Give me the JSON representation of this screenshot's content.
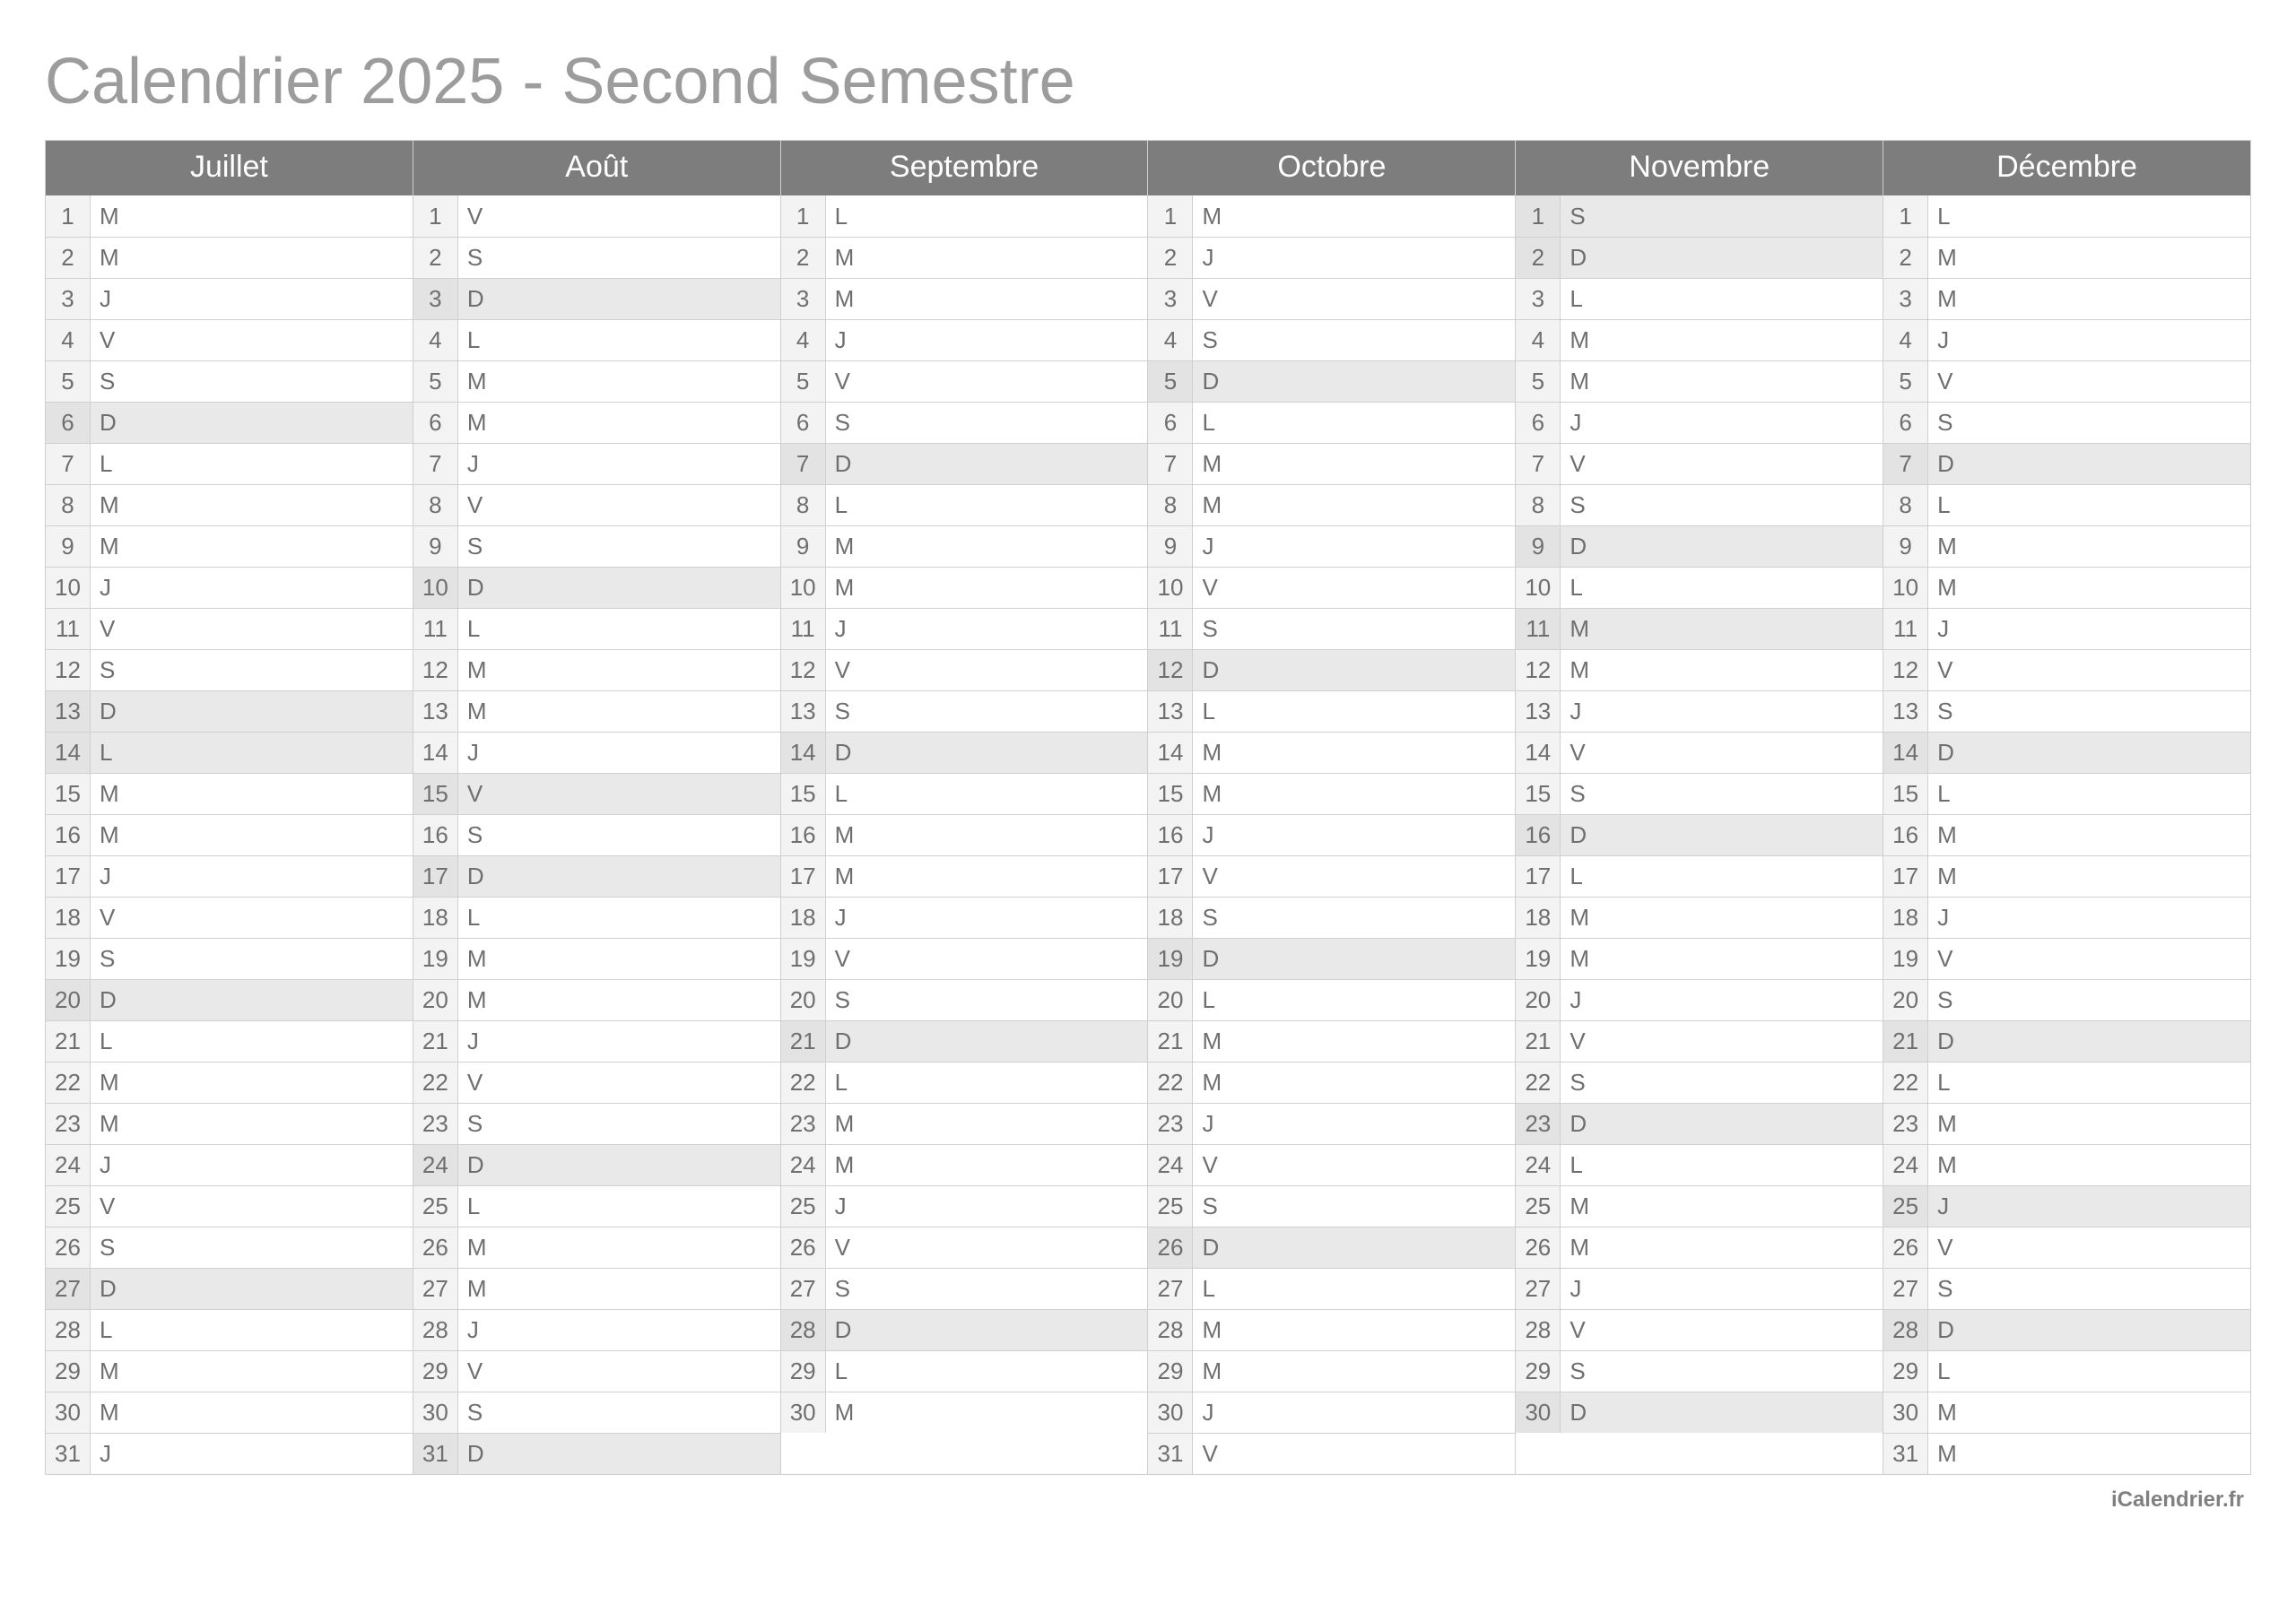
{
  "title": "Calendrier 2025 - Second Semestre",
  "footer": "iCalendrier.fr",
  "months": [
    {
      "name": "Juillet",
      "days": [
        {
          "n": 1,
          "wd": "M",
          "shaded": false
        },
        {
          "n": 2,
          "wd": "M",
          "shaded": false
        },
        {
          "n": 3,
          "wd": "J",
          "shaded": false
        },
        {
          "n": 4,
          "wd": "V",
          "shaded": false
        },
        {
          "n": 5,
          "wd": "S",
          "shaded": false
        },
        {
          "n": 6,
          "wd": "D",
          "shaded": true
        },
        {
          "n": 7,
          "wd": "L",
          "shaded": false
        },
        {
          "n": 8,
          "wd": "M",
          "shaded": false
        },
        {
          "n": 9,
          "wd": "M",
          "shaded": false
        },
        {
          "n": 10,
          "wd": "J",
          "shaded": false
        },
        {
          "n": 11,
          "wd": "V",
          "shaded": false
        },
        {
          "n": 12,
          "wd": "S",
          "shaded": false
        },
        {
          "n": 13,
          "wd": "D",
          "shaded": true
        },
        {
          "n": 14,
          "wd": "L",
          "shaded": true
        },
        {
          "n": 15,
          "wd": "M",
          "shaded": false
        },
        {
          "n": 16,
          "wd": "M",
          "shaded": false
        },
        {
          "n": 17,
          "wd": "J",
          "shaded": false
        },
        {
          "n": 18,
          "wd": "V",
          "shaded": false
        },
        {
          "n": 19,
          "wd": "S",
          "shaded": false
        },
        {
          "n": 20,
          "wd": "D",
          "shaded": true
        },
        {
          "n": 21,
          "wd": "L",
          "shaded": false
        },
        {
          "n": 22,
          "wd": "M",
          "shaded": false
        },
        {
          "n": 23,
          "wd": "M",
          "shaded": false
        },
        {
          "n": 24,
          "wd": "J",
          "shaded": false
        },
        {
          "n": 25,
          "wd": "V",
          "shaded": false
        },
        {
          "n": 26,
          "wd": "S",
          "shaded": false
        },
        {
          "n": 27,
          "wd": "D",
          "shaded": true
        },
        {
          "n": 28,
          "wd": "L",
          "shaded": false
        },
        {
          "n": 29,
          "wd": "M",
          "shaded": false
        },
        {
          "n": 30,
          "wd": "M",
          "shaded": false
        },
        {
          "n": 31,
          "wd": "J",
          "shaded": false
        }
      ]
    },
    {
      "name": "Août",
      "days": [
        {
          "n": 1,
          "wd": "V",
          "shaded": false
        },
        {
          "n": 2,
          "wd": "S",
          "shaded": false
        },
        {
          "n": 3,
          "wd": "D",
          "shaded": true
        },
        {
          "n": 4,
          "wd": "L",
          "shaded": false
        },
        {
          "n": 5,
          "wd": "M",
          "shaded": false
        },
        {
          "n": 6,
          "wd": "M",
          "shaded": false
        },
        {
          "n": 7,
          "wd": "J",
          "shaded": false
        },
        {
          "n": 8,
          "wd": "V",
          "shaded": false
        },
        {
          "n": 9,
          "wd": "S",
          "shaded": false
        },
        {
          "n": 10,
          "wd": "D",
          "shaded": true
        },
        {
          "n": 11,
          "wd": "L",
          "shaded": false
        },
        {
          "n": 12,
          "wd": "M",
          "shaded": false
        },
        {
          "n": 13,
          "wd": "M",
          "shaded": false
        },
        {
          "n": 14,
          "wd": "J",
          "shaded": false
        },
        {
          "n": 15,
          "wd": "V",
          "shaded": true
        },
        {
          "n": 16,
          "wd": "S",
          "shaded": false
        },
        {
          "n": 17,
          "wd": "D",
          "shaded": true
        },
        {
          "n": 18,
          "wd": "L",
          "shaded": false
        },
        {
          "n": 19,
          "wd": "M",
          "shaded": false
        },
        {
          "n": 20,
          "wd": "M",
          "shaded": false
        },
        {
          "n": 21,
          "wd": "J",
          "shaded": false
        },
        {
          "n": 22,
          "wd": "V",
          "shaded": false
        },
        {
          "n": 23,
          "wd": "S",
          "shaded": false
        },
        {
          "n": 24,
          "wd": "D",
          "shaded": true
        },
        {
          "n": 25,
          "wd": "L",
          "shaded": false
        },
        {
          "n": 26,
          "wd": "M",
          "shaded": false
        },
        {
          "n": 27,
          "wd": "M",
          "shaded": false
        },
        {
          "n": 28,
          "wd": "J",
          "shaded": false
        },
        {
          "n": 29,
          "wd": "V",
          "shaded": false
        },
        {
          "n": 30,
          "wd": "S",
          "shaded": false
        },
        {
          "n": 31,
          "wd": "D",
          "shaded": true
        }
      ]
    },
    {
      "name": "Septembre",
      "days": [
        {
          "n": 1,
          "wd": "L",
          "shaded": false
        },
        {
          "n": 2,
          "wd": "M",
          "shaded": false
        },
        {
          "n": 3,
          "wd": "M",
          "shaded": false
        },
        {
          "n": 4,
          "wd": "J",
          "shaded": false
        },
        {
          "n": 5,
          "wd": "V",
          "shaded": false
        },
        {
          "n": 6,
          "wd": "S",
          "shaded": false
        },
        {
          "n": 7,
          "wd": "D",
          "shaded": true
        },
        {
          "n": 8,
          "wd": "L",
          "shaded": false
        },
        {
          "n": 9,
          "wd": "M",
          "shaded": false
        },
        {
          "n": 10,
          "wd": "M",
          "shaded": false
        },
        {
          "n": 11,
          "wd": "J",
          "shaded": false
        },
        {
          "n": 12,
          "wd": "V",
          "shaded": false
        },
        {
          "n": 13,
          "wd": "S",
          "shaded": false
        },
        {
          "n": 14,
          "wd": "D",
          "shaded": true
        },
        {
          "n": 15,
          "wd": "L",
          "shaded": false
        },
        {
          "n": 16,
          "wd": "M",
          "shaded": false
        },
        {
          "n": 17,
          "wd": "M",
          "shaded": false
        },
        {
          "n": 18,
          "wd": "J",
          "shaded": false
        },
        {
          "n": 19,
          "wd": "V",
          "shaded": false
        },
        {
          "n": 20,
          "wd": "S",
          "shaded": false
        },
        {
          "n": 21,
          "wd": "D",
          "shaded": true
        },
        {
          "n": 22,
          "wd": "L",
          "shaded": false
        },
        {
          "n": 23,
          "wd": "M",
          "shaded": false
        },
        {
          "n": 24,
          "wd": "M",
          "shaded": false
        },
        {
          "n": 25,
          "wd": "J",
          "shaded": false
        },
        {
          "n": 26,
          "wd": "V",
          "shaded": false
        },
        {
          "n": 27,
          "wd": "S",
          "shaded": false
        },
        {
          "n": 28,
          "wd": "D",
          "shaded": true
        },
        {
          "n": 29,
          "wd": "L",
          "shaded": false
        },
        {
          "n": 30,
          "wd": "M",
          "shaded": false
        }
      ]
    },
    {
      "name": "Octobre",
      "days": [
        {
          "n": 1,
          "wd": "M",
          "shaded": false
        },
        {
          "n": 2,
          "wd": "J",
          "shaded": false
        },
        {
          "n": 3,
          "wd": "V",
          "shaded": false
        },
        {
          "n": 4,
          "wd": "S",
          "shaded": false
        },
        {
          "n": 5,
          "wd": "D",
          "shaded": true
        },
        {
          "n": 6,
          "wd": "L",
          "shaded": false
        },
        {
          "n": 7,
          "wd": "M",
          "shaded": false
        },
        {
          "n": 8,
          "wd": "M",
          "shaded": false
        },
        {
          "n": 9,
          "wd": "J",
          "shaded": false
        },
        {
          "n": 10,
          "wd": "V",
          "shaded": false
        },
        {
          "n": 11,
          "wd": "S",
          "shaded": false
        },
        {
          "n": 12,
          "wd": "D",
          "shaded": true
        },
        {
          "n": 13,
          "wd": "L",
          "shaded": false
        },
        {
          "n": 14,
          "wd": "M",
          "shaded": false
        },
        {
          "n": 15,
          "wd": "M",
          "shaded": false
        },
        {
          "n": 16,
          "wd": "J",
          "shaded": false
        },
        {
          "n": 17,
          "wd": "V",
          "shaded": false
        },
        {
          "n": 18,
          "wd": "S",
          "shaded": false
        },
        {
          "n": 19,
          "wd": "D",
          "shaded": true
        },
        {
          "n": 20,
          "wd": "L",
          "shaded": false
        },
        {
          "n": 21,
          "wd": "M",
          "shaded": false
        },
        {
          "n": 22,
          "wd": "M",
          "shaded": false
        },
        {
          "n": 23,
          "wd": "J",
          "shaded": false
        },
        {
          "n": 24,
          "wd": "V",
          "shaded": false
        },
        {
          "n": 25,
          "wd": "S",
          "shaded": false
        },
        {
          "n": 26,
          "wd": "D",
          "shaded": true
        },
        {
          "n": 27,
          "wd": "L",
          "shaded": false
        },
        {
          "n": 28,
          "wd": "M",
          "shaded": false
        },
        {
          "n": 29,
          "wd": "M",
          "shaded": false
        },
        {
          "n": 30,
          "wd": "J",
          "shaded": false
        },
        {
          "n": 31,
          "wd": "V",
          "shaded": false
        }
      ]
    },
    {
      "name": "Novembre",
      "days": [
        {
          "n": 1,
          "wd": "S",
          "shaded": true
        },
        {
          "n": 2,
          "wd": "D",
          "shaded": true
        },
        {
          "n": 3,
          "wd": "L",
          "shaded": false
        },
        {
          "n": 4,
          "wd": "M",
          "shaded": false
        },
        {
          "n": 5,
          "wd": "M",
          "shaded": false
        },
        {
          "n": 6,
          "wd": "J",
          "shaded": false
        },
        {
          "n": 7,
          "wd": "V",
          "shaded": false
        },
        {
          "n": 8,
          "wd": "S",
          "shaded": false
        },
        {
          "n": 9,
          "wd": "D",
          "shaded": true
        },
        {
          "n": 10,
          "wd": "L",
          "shaded": false
        },
        {
          "n": 11,
          "wd": "M",
          "shaded": true
        },
        {
          "n": 12,
          "wd": "M",
          "shaded": false
        },
        {
          "n": 13,
          "wd": "J",
          "shaded": false
        },
        {
          "n": 14,
          "wd": "V",
          "shaded": false
        },
        {
          "n": 15,
          "wd": "S",
          "shaded": false
        },
        {
          "n": 16,
          "wd": "D",
          "shaded": true
        },
        {
          "n": 17,
          "wd": "L",
          "shaded": false
        },
        {
          "n": 18,
          "wd": "M",
          "shaded": false
        },
        {
          "n": 19,
          "wd": "M",
          "shaded": false
        },
        {
          "n": 20,
          "wd": "J",
          "shaded": false
        },
        {
          "n": 21,
          "wd": "V",
          "shaded": false
        },
        {
          "n": 22,
          "wd": "S",
          "shaded": false
        },
        {
          "n": 23,
          "wd": "D",
          "shaded": true
        },
        {
          "n": 24,
          "wd": "L",
          "shaded": false
        },
        {
          "n": 25,
          "wd": "M",
          "shaded": false
        },
        {
          "n": 26,
          "wd": "M",
          "shaded": false
        },
        {
          "n": 27,
          "wd": "J",
          "shaded": false
        },
        {
          "n": 28,
          "wd": "V",
          "shaded": false
        },
        {
          "n": 29,
          "wd": "S",
          "shaded": false
        },
        {
          "n": 30,
          "wd": "D",
          "shaded": true
        }
      ]
    },
    {
      "name": "Décembre",
      "days": [
        {
          "n": 1,
          "wd": "L",
          "shaded": false
        },
        {
          "n": 2,
          "wd": "M",
          "shaded": false
        },
        {
          "n": 3,
          "wd": "M",
          "shaded": false
        },
        {
          "n": 4,
          "wd": "J",
          "shaded": false
        },
        {
          "n": 5,
          "wd": "V",
          "shaded": false
        },
        {
          "n": 6,
          "wd": "S",
          "shaded": false
        },
        {
          "n": 7,
          "wd": "D",
          "shaded": true
        },
        {
          "n": 8,
          "wd": "L",
          "shaded": false
        },
        {
          "n": 9,
          "wd": "M",
          "shaded": false
        },
        {
          "n": 10,
          "wd": "M",
          "shaded": false
        },
        {
          "n": 11,
          "wd": "J",
          "shaded": false
        },
        {
          "n": 12,
          "wd": "V",
          "shaded": false
        },
        {
          "n": 13,
          "wd": "S",
          "shaded": false
        },
        {
          "n": 14,
          "wd": "D",
          "shaded": true
        },
        {
          "n": 15,
          "wd": "L",
          "shaded": false
        },
        {
          "n": 16,
          "wd": "M",
          "shaded": false
        },
        {
          "n": 17,
          "wd": "M",
          "shaded": false
        },
        {
          "n": 18,
          "wd": "J",
          "shaded": false
        },
        {
          "n": 19,
          "wd": "V",
          "shaded": false
        },
        {
          "n": 20,
          "wd": "S",
          "shaded": false
        },
        {
          "n": 21,
          "wd": "D",
          "shaded": true
        },
        {
          "n": 22,
          "wd": "L",
          "shaded": false
        },
        {
          "n": 23,
          "wd": "M",
          "shaded": false
        },
        {
          "n": 24,
          "wd": "M",
          "shaded": false
        },
        {
          "n": 25,
          "wd": "J",
          "shaded": true
        },
        {
          "n": 26,
          "wd": "V",
          "shaded": false
        },
        {
          "n": 27,
          "wd": "S",
          "shaded": false
        },
        {
          "n": 28,
          "wd": "D",
          "shaded": true
        },
        {
          "n": 29,
          "wd": "L",
          "shaded": false
        },
        {
          "n": 30,
          "wd": "M",
          "shaded": false
        },
        {
          "n": 31,
          "wd": "M",
          "shaded": false
        }
      ]
    }
  ]
}
